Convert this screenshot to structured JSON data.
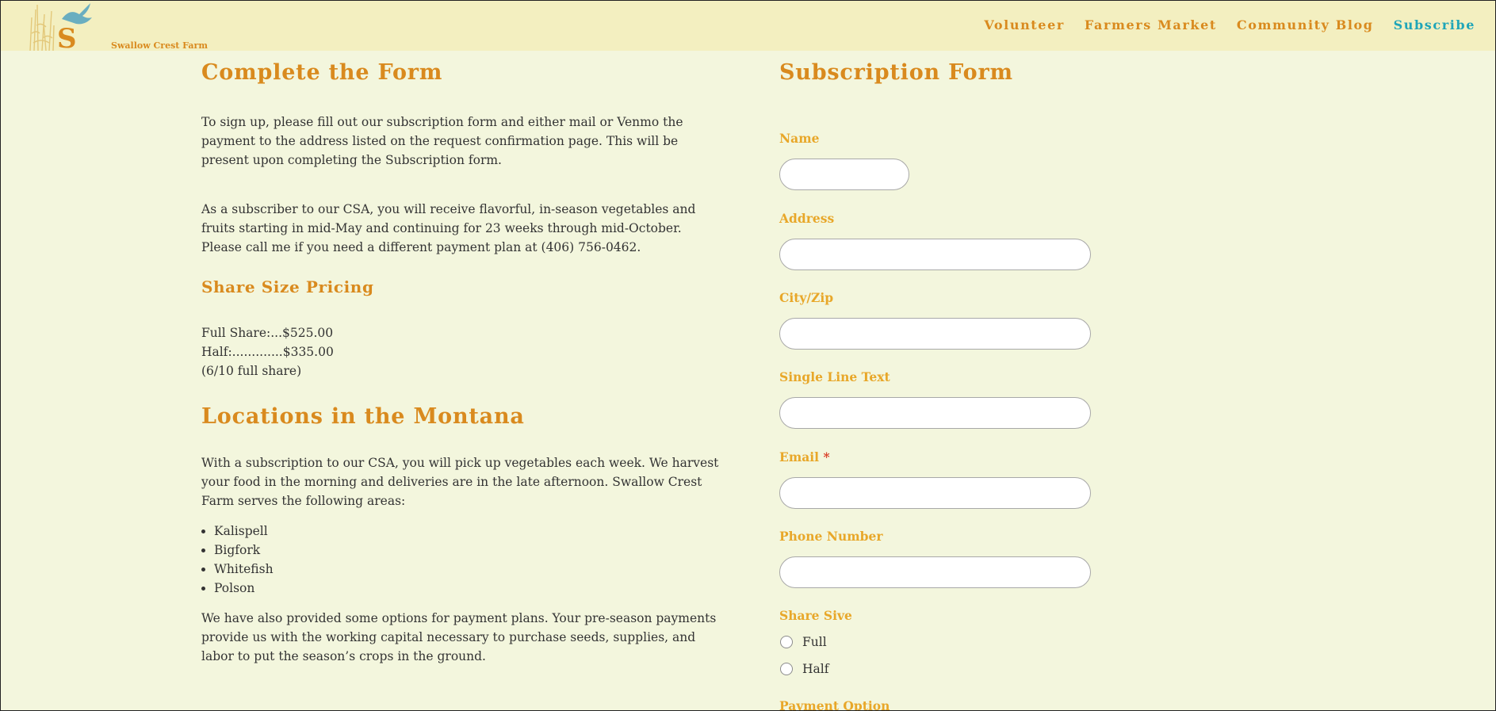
{
  "site": {
    "logo_text": "Swallow Crest Farm",
    "accent": "#d98a1e",
    "active_accent": "#1fa5b8",
    "label_color": "#e8a729"
  },
  "nav": {
    "items": [
      {
        "label": "Volunteer"
      },
      {
        "label": "Farmers Market"
      },
      {
        "label": "Community Blog"
      },
      {
        "label": "Subscribe",
        "active": true
      }
    ]
  },
  "left": {
    "title": "Complete the Form",
    "intro": "To sign up, please fill out our subscription form and either mail or Venmo the payment to the address listed on the request confirmation page. This will be present upon completing the Subscription form.",
    "subscriber_text": "As a subscriber to our CSA, you will receive flavorful, in-season vegetables and fruits starting in mid-May and continuing for 23 weeks through mid-October. Please call me if you need a different payment plan at (406) 756-0462.",
    "pricing_title": "Share Size Pricing",
    "pricing_lines": [
      "Full Share:...$525.00",
      "Half:.............$335.00",
      "(6/10 full share)"
    ],
    "locations_title": "Locations in the Montana",
    "locations_text": "With a subscription to our CSA, you will pick up vegetables each week. We harvest your food in the morning and deliveries are in the late afternoon. Swallow Crest Farm serves the following areas:",
    "locations": [
      "Kalispell",
      "Bigfork",
      "Whitefish",
      "Polson"
    ],
    "payment_text": "We have also provided some options for payment plans. Your pre-season payments provide us with the working capital necessary to purchase seeds, supplies, and labor to put the season’s crops in the ground."
  },
  "form": {
    "title": "Subscription Form",
    "name_label": "Name",
    "address_label": "Address",
    "cityzip_label": "City/Zip",
    "single_line_label": "Single Line Text",
    "email_label": "Email",
    "required_mark": "*",
    "phone_label": "Phone Number",
    "share_label": "Share Sive",
    "share_options": [
      "Full",
      "Half"
    ],
    "payment_label": "Payment Option"
  }
}
